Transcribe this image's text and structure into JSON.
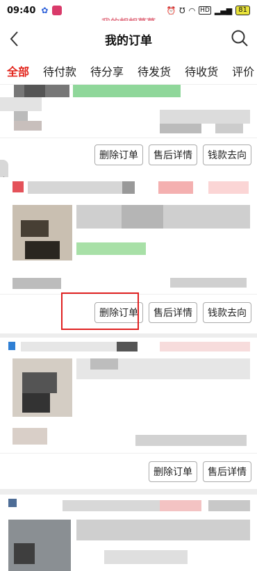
{
  "status": {
    "time": "09:40",
    "watermark": "我的朝朝暮暮",
    "network": "HD",
    "battery": "81"
  },
  "nav": {
    "title": "我的订单"
  },
  "tabs": [
    {
      "label": "全部",
      "active": true
    },
    {
      "label": "待付款"
    },
    {
      "label": "待分享"
    },
    {
      "label": "待发货"
    },
    {
      "label": "待收货"
    },
    {
      "label": "评价"
    }
  ],
  "orders": [
    {
      "actions": [
        "删除订单",
        "售后详情",
        "钱款去向"
      ]
    },
    {
      "actions": [
        "删除订单",
        "售后详情",
        "钱款去向"
      ]
    },
    {
      "actions": [
        "删除订单",
        "售后详情"
      ]
    }
  ],
  "colors": {
    "accent": "#e2231a",
    "highlight_box": "#e02020",
    "watermark": "#e37a8a"
  }
}
